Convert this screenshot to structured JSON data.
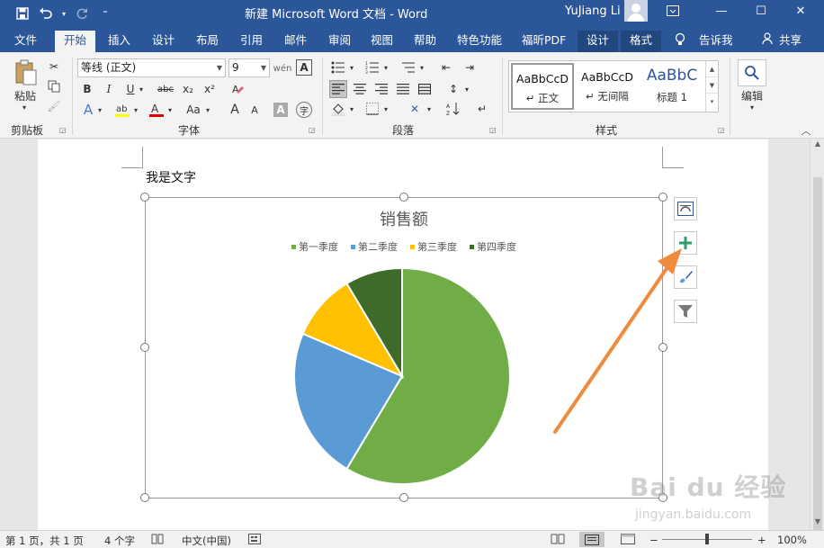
{
  "titlebar": {
    "doc_title": "新建 Microsoft Word 文档  -  Word",
    "user_name": "YuJiang Li",
    "qat": {
      "save_icon": "save-icon",
      "undo_icon": "undo-icon",
      "redo_icon": "redo-icon",
      "customize_icon": "chevron-down-icon"
    },
    "window_controls": [
      "ribbon-options-icon",
      "minimize-icon",
      "maximize-icon",
      "close-icon"
    ]
  },
  "tabs": {
    "items": [
      "文件",
      "开始",
      "插入",
      "设计",
      "布局",
      "引用",
      "邮件",
      "审阅",
      "视图",
      "帮助",
      "特色功能",
      "福昕PDF",
      "设计",
      "格式"
    ],
    "active": "开始",
    "tell_me": "告诉我",
    "share": "共享"
  },
  "ribbon": {
    "clipboard": {
      "label": "剪贴板",
      "paste": "粘贴"
    },
    "font": {
      "label": "字体",
      "font_name": "等线 (正文)",
      "font_size": "9",
      "buttons": [
        "B",
        "I",
        "U",
        "abc",
        "x₂",
        "x²",
        "Aa"
      ],
      "grow": "A",
      "shrink": "A"
    },
    "paragraph": {
      "label": "段落"
    },
    "styles": {
      "label": "样式",
      "items": [
        {
          "sample": "AaBbCcD",
          "name": "↵ 正文"
        },
        {
          "sample": "AaBbCcD",
          "name": "↵ 无间隔"
        },
        {
          "sample": "AaBbC",
          "name": "标题 1"
        }
      ]
    },
    "editing": {
      "label": "编辑"
    }
  },
  "document": {
    "body_text": "我是文字"
  },
  "chart_data": {
    "type": "pie",
    "title": "销售额",
    "categories": [
      "第一季度",
      "第二季度",
      "第三季度",
      "第四季度"
    ],
    "values": [
      8.2,
      3.2,
      1.4,
      1.2
    ],
    "colors": [
      "#70ad47",
      "#5b9bd5",
      "#ffc000",
      "#3e6b2a"
    ],
    "legend": "top"
  },
  "chart_side_buttons": [
    "layout-options-icon",
    "chart-elements-plus-icon",
    "chart-styles-brush-icon",
    "chart-filters-funnel-icon"
  ],
  "statusbar": {
    "page": "第 1 页，共 1 页",
    "words": "4 个字",
    "language": "中文(中国)",
    "zoom": "100%",
    "zoom_minus": "−",
    "zoom_plus": "+"
  },
  "watermark": {
    "main": "Bai du 经验",
    "sub": "jingyan.baidu.com"
  }
}
